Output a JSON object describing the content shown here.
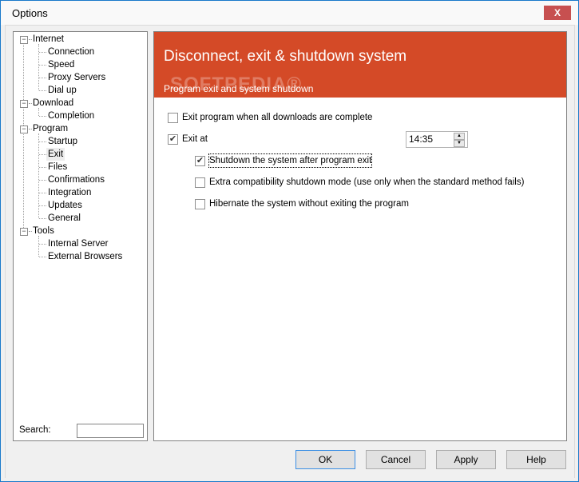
{
  "window": {
    "title": "Options",
    "close_glyph": "X"
  },
  "tree": {
    "nodes": [
      {
        "label": "Internet",
        "level": 0,
        "expander": "−"
      },
      {
        "label": "Connection",
        "level": 1
      },
      {
        "label": "Speed",
        "level": 1
      },
      {
        "label": "Proxy Servers",
        "level": 1
      },
      {
        "label": "Dial up",
        "level": 1
      },
      {
        "label": "Download",
        "level": 0,
        "expander": "−"
      },
      {
        "label": "Completion",
        "level": 1
      },
      {
        "label": "Program",
        "level": 0,
        "expander": "−"
      },
      {
        "label": "Startup",
        "level": 1
      },
      {
        "label": "Exit",
        "level": 1,
        "selected": true
      },
      {
        "label": "Files",
        "level": 1
      },
      {
        "label": "Confirmations",
        "level": 1
      },
      {
        "label": "Integration",
        "level": 1
      },
      {
        "label": "Updates",
        "level": 1
      },
      {
        "label": "General",
        "level": 1
      },
      {
        "label": "Tools",
        "level": 0,
        "expander": "−"
      },
      {
        "label": "Internal Server",
        "level": 1
      },
      {
        "label": "External Browsers",
        "level": 1
      }
    ],
    "search_label": "Search:",
    "search_value": ""
  },
  "panel": {
    "title": "Disconnect, exit & shutdown system",
    "subtitle": "Program exit and system shutdown",
    "watermark": "SOFTPEDIA®",
    "accent_color": "#d44a27",
    "options": {
      "exit_when_complete": {
        "label": "Exit program when all downloads are complete",
        "checked": false
      },
      "exit_at": {
        "label": "Exit at",
        "checked": true
      },
      "shutdown_after_exit": {
        "label": "Shutdown the system after program exit",
        "checked": true
      },
      "extra_compat": {
        "label": "Extra compatibility shutdown mode (use only when the standard method fails)",
        "checked": false
      },
      "hibernate": {
        "label": "Hibernate the system without exiting the program",
        "checked": false
      }
    },
    "exit_time": "14:35",
    "check_glyph": "✔"
  },
  "buttons": {
    "ok": "OK",
    "cancel": "Cancel",
    "apply": "Apply",
    "help": "Help"
  }
}
